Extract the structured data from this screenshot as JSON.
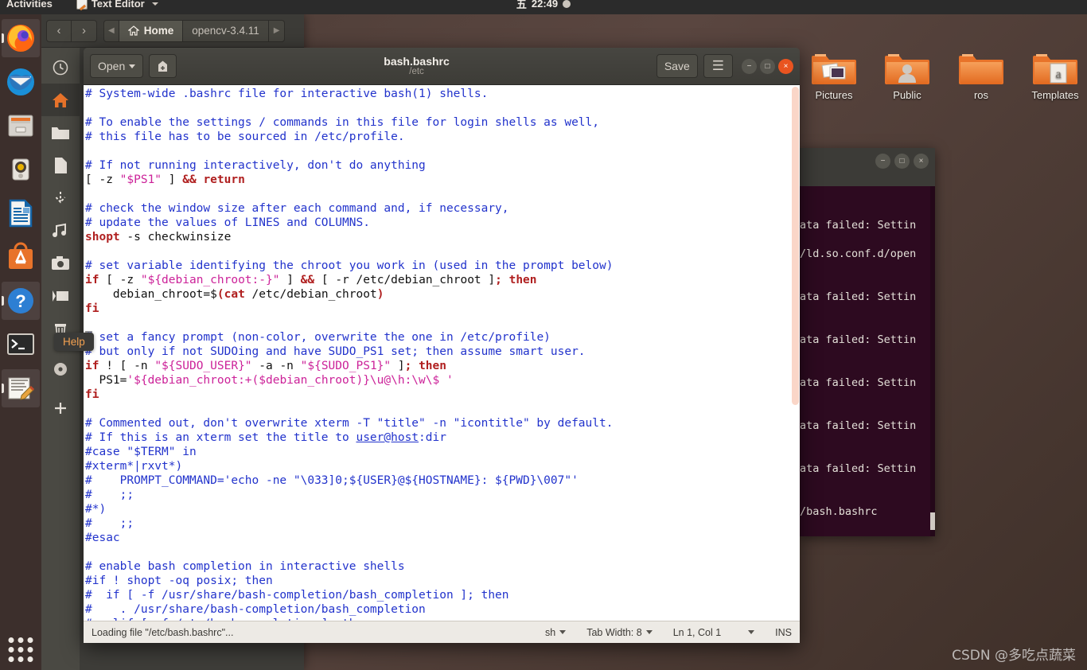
{
  "topbar": {
    "activities": "Activities",
    "app_name": "Text Editor",
    "app_icon": "text-editor-icon",
    "clock_day": "五",
    "clock_time": "22:49"
  },
  "dock": {
    "items": [
      {
        "name": "firefox",
        "label": "Firefox"
      },
      {
        "name": "thunderbird",
        "label": "Thunderbird Mail"
      },
      {
        "name": "files",
        "label": "Files"
      },
      {
        "name": "rhythmbox",
        "label": "Rhythmbox"
      },
      {
        "name": "libreoffice-writer",
        "label": "LibreOffice Writer"
      },
      {
        "name": "ubuntu-software",
        "label": "Ubuntu Software"
      },
      {
        "name": "help",
        "label": "Help"
      },
      {
        "name": "terminal",
        "label": "Terminal"
      },
      {
        "name": "text-editor",
        "label": "Text Editor"
      }
    ],
    "show_apps_label": "Show Applications",
    "tooltip": "Help"
  },
  "nautilus": {
    "back_label": "‹",
    "forward_label": "›",
    "crumb_prev": "◀",
    "crumb_next": "▶",
    "breadcrumbs": [
      {
        "label": "Home",
        "active": true
      },
      {
        "label": "opencv-3.4.11",
        "active": false
      }
    ],
    "sidebar": [
      {
        "name": "recent",
        "label": "Recent"
      },
      {
        "name": "home",
        "label": "Home"
      },
      {
        "name": "documents",
        "label": "Documents"
      },
      {
        "name": "desktop",
        "label": "Desktop"
      },
      {
        "name": "downloads",
        "label": "Downloads"
      },
      {
        "name": "music",
        "label": "Music"
      },
      {
        "name": "pictures",
        "label": "Pictures"
      },
      {
        "name": "videos",
        "label": "Videos"
      },
      {
        "name": "trash",
        "label": "Trash"
      },
      {
        "name": "other-locations",
        "label": "Other Locations"
      },
      {
        "name": "add-bookmark",
        "label": "+"
      }
    ]
  },
  "desktop_icons": [
    {
      "name": "pictures",
      "label": "Pictures"
    },
    {
      "name": "public",
      "label": "Public"
    },
    {
      "name": "ros",
      "label": "ros"
    },
    {
      "name": "templates",
      "label": "Templates"
    }
  ],
  "terminal": {
    "minimize": "−",
    "maximize": "□",
    "close": "×",
    "lines": [
      "",
      "",
      "ata failed: Settin",
      "",
      "/ld.so.conf.d/open",
      "",
      "",
      "ata failed: Settin",
      "",
      "",
      "ata failed: Settin",
      "",
      "",
      "ata failed: Settin",
      "",
      "",
      "ata failed: Settin",
      "",
      "",
      "ata failed: Settin",
      "",
      "",
      "/bash.bashrc"
    ]
  },
  "gedit": {
    "open_label": "Open",
    "save_label": "Save",
    "menu_label": "☰",
    "new_doc_icon": "new-document-icon",
    "title": "bash.bashrc",
    "subtitle": "/etc",
    "minimize": "−",
    "maximize": "□",
    "close": "×",
    "status": {
      "message": "Loading file \"/etc/bash.bashrc\"...",
      "language": "sh",
      "tab_width": "Tab Width: 8",
      "position": "Ln 1, Col 1",
      "insert_mode": "INS"
    },
    "code_lines": [
      [
        {
          "t": "# System-wide .bashrc file for interactive bash(1) shells.",
          "c": "cm"
        }
      ],
      [],
      [
        {
          "t": "# To enable the settings / commands in this file for login shells as well,",
          "c": "cm"
        }
      ],
      [
        {
          "t": "# this file has to be sourced in /etc/profile.",
          "c": "cm"
        }
      ],
      [],
      [
        {
          "t": "# If not running interactively, don't do anything",
          "c": "cm"
        }
      ],
      [
        {
          "t": "[ -z ",
          "c": "pl"
        },
        {
          "t": "\"$PS1\"",
          "c": "st"
        },
        {
          "t": " ] ",
          "c": "pl"
        },
        {
          "t": "&& return",
          "c": "kw"
        }
      ],
      [],
      [
        {
          "t": "# check the window size after each command and, if necessary,",
          "c": "cm"
        }
      ],
      [
        {
          "t": "# update the values of LINES and COLUMNS.",
          "c": "cm"
        }
      ],
      [
        {
          "t": "shopt",
          "c": "kw"
        },
        {
          "t": " -s checkwinsize",
          "c": "pl"
        }
      ],
      [],
      [
        {
          "t": "# set variable identifying the chroot you work in (used in the prompt below)",
          "c": "cm"
        }
      ],
      [
        {
          "t": "if",
          "c": "kw"
        },
        {
          "t": " [ -z ",
          "c": "pl"
        },
        {
          "t": "\"${debian_chroot:-}\"",
          "c": "st"
        },
        {
          "t": " ] ",
          "c": "pl"
        },
        {
          "t": "&&",
          "c": "kw"
        },
        {
          "t": " [ -r /etc/debian_chroot ]",
          "c": "pl"
        },
        {
          "t": "; then",
          "c": "kw"
        }
      ],
      [
        {
          "t": "    debian_chroot=$",
          "c": "pl"
        },
        {
          "t": "(",
          "c": "kw"
        },
        {
          "t": "cat",
          "c": "kw"
        },
        {
          "t": " /etc/debian_chroot",
          "c": "pl"
        },
        {
          "t": ")",
          "c": "kw"
        }
      ],
      [
        {
          "t": "fi",
          "c": "kw"
        }
      ],
      [],
      [
        {
          "t": "# set a fancy prompt (non-color, overwrite the one in /etc/profile)",
          "c": "cm",
          "cursor": true
        }
      ],
      [
        {
          "t": "# but only if not SUDOing and have SUDO_PS1 set; then assume smart user.",
          "c": "cm"
        }
      ],
      [
        {
          "t": "if",
          "c": "kw"
        },
        {
          "t": " ! [ -n ",
          "c": "pl"
        },
        {
          "t": "\"${SUDO_USER}\"",
          "c": "st"
        },
        {
          "t": " -a -n ",
          "c": "pl"
        },
        {
          "t": "\"${SUDO_PS1}\"",
          "c": "st"
        },
        {
          "t": " ]",
          "c": "pl"
        },
        {
          "t": "; then",
          "c": "kw"
        }
      ],
      [
        {
          "t": "  PS1=",
          "c": "pl"
        },
        {
          "t": "'${debian_chroot:+($debian_chroot)}\\u@\\h:\\w\\$ '",
          "c": "st"
        }
      ],
      [
        {
          "t": "fi",
          "c": "kw"
        }
      ],
      [],
      [
        {
          "t": "# Commented out, don't overwrite xterm -T \"title\" -n \"icontitle\" by default.",
          "c": "cm"
        }
      ],
      [
        {
          "t": "# If this is an xterm set the title to ",
          "c": "cm"
        },
        {
          "t": "user@host",
          "c": "cm ul"
        },
        {
          "t": ":dir",
          "c": "cm"
        }
      ],
      [
        {
          "t": "#case \"$TERM\" in",
          "c": "cm"
        }
      ],
      [
        {
          "t": "#xterm*|rxvt*)",
          "c": "cm"
        }
      ],
      [
        {
          "t": "#    PROMPT_COMMAND='echo -ne \"\\033]0;${USER}@${HOSTNAME}: ${PWD}\\007\"'",
          "c": "cm"
        }
      ],
      [
        {
          "t": "#    ;;",
          "c": "cm"
        }
      ],
      [
        {
          "t": "#*)",
          "c": "cm"
        }
      ],
      [
        {
          "t": "#    ;;",
          "c": "cm"
        }
      ],
      [
        {
          "t": "#esac",
          "c": "cm"
        }
      ],
      [],
      [
        {
          "t": "# enable bash completion in interactive shells",
          "c": "cm"
        }
      ],
      [
        {
          "t": "#if ! shopt -oq posix; then",
          "c": "cm"
        }
      ],
      [
        {
          "t": "#  if [ -f /usr/share/bash-completion/bash_completion ]; then",
          "c": "cm"
        }
      ],
      [
        {
          "t": "#    . /usr/share/bash-completion/bash_completion",
          "c": "cm"
        }
      ],
      [
        {
          "t": "#  elif [ -f /etc/bash_completion ]; then",
          "c": "cm"
        }
      ]
    ]
  },
  "watermark": "CSDN @多吃点蔬菜",
  "colors": {
    "accent_orange": "#e95420",
    "comment_blue": "#2233cc",
    "keyword_red": "#b02020",
    "string_pink": "#cc2299",
    "terminal_bg": "#2d0a20"
  }
}
